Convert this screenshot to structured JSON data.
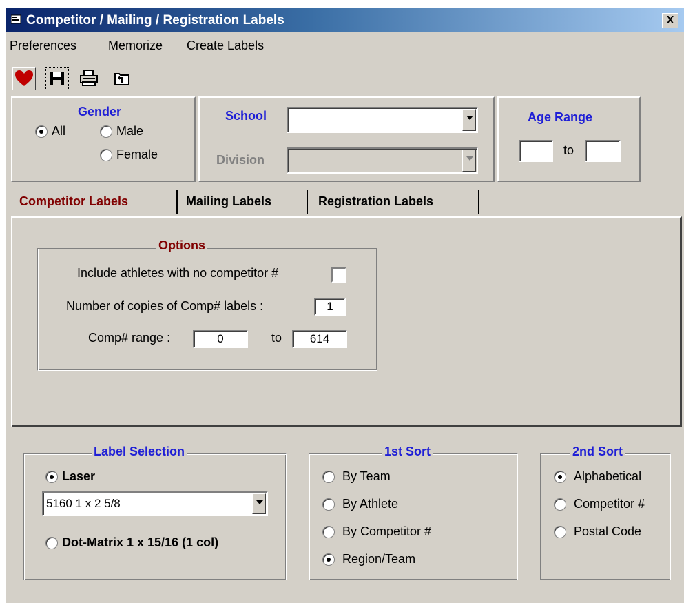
{
  "window": {
    "title": "Competitor / Mailing / Registration Labels",
    "close_glyph": "X"
  },
  "menu": [
    "Preferences",
    "Memorize",
    "Create Labels"
  ],
  "toolbar": {
    "icons": [
      "heart-icon",
      "save-icon",
      "print-icon",
      "folder-up-icon"
    ],
    "heart_color": "#c00000"
  },
  "gender": {
    "title": "Gender",
    "options": [
      "All",
      "Male",
      "Female"
    ],
    "selected": "All"
  },
  "school": {
    "label": "School",
    "value": ""
  },
  "division": {
    "label": "Division",
    "value": ""
  },
  "age_range": {
    "title": "Age Range",
    "from": "",
    "to_label": "to",
    "to": ""
  },
  "tabs": [
    "Competitor Labels",
    "Mailing Labels",
    "Registration Labels"
  ],
  "active_tab": "Competitor Labels",
  "options": {
    "title": "Options",
    "no_comp_label": "Include athletes with no competitor #",
    "copies_label": "Number of copies of Comp# labels :",
    "copies_value": "1",
    "range_label": "Comp# range :",
    "range_from": "0",
    "range_to_label": "to",
    "range_to": "614"
  },
  "label_selection": {
    "title": "Label Selection",
    "laser_label": "Laser",
    "laser_value": "5160  1 x 2 5/8",
    "dot_matrix_label": "Dot-Matrix 1 x 15/16 (1 col)",
    "selected": "Laser"
  },
  "sort1": {
    "title": "1st Sort",
    "options": [
      "By Team",
      "By Athlete",
      "By Competitor #",
      "Region/Team"
    ],
    "selected": "Region/Team"
  },
  "sort2": {
    "title": "2nd Sort",
    "options": [
      "Alphabetical",
      "Competitor #",
      "Postal Code"
    ],
    "selected": "Alphabetical"
  },
  "colors": {
    "title_blue": "#0a246a",
    "label_blue": "#1f1fd6",
    "tab_maroon": "#800000",
    "face": "#d4d0c8"
  }
}
